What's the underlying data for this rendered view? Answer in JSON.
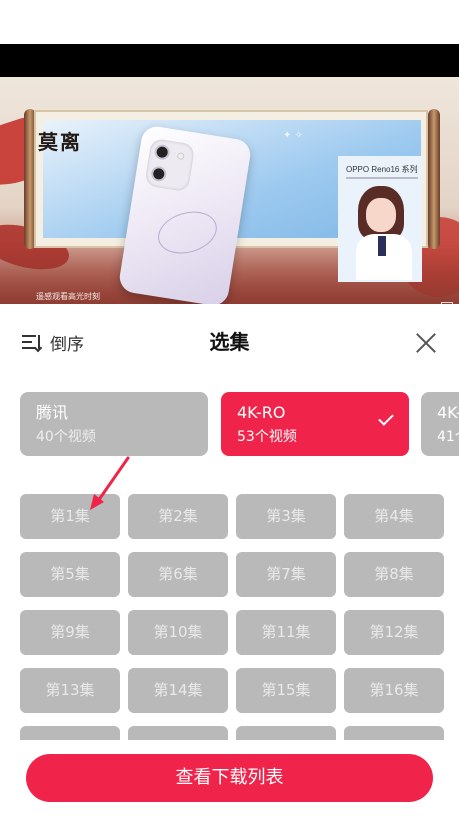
{
  "video": {
    "logo_text": "莫离",
    "brand": "OPPO Reno16 系列",
    "caption": "遥感观看高光时刻"
  },
  "panel": {
    "sort_label": "倒序",
    "title": "选集",
    "sources": [
      {
        "name": "腾讯",
        "count": "40个视频"
      },
      {
        "name": "4K-RO",
        "count": "53个视频"
      },
      {
        "name": "4K-",
        "count": "41个"
      }
    ],
    "selected_source_index": 1,
    "episodes": [
      "第1集",
      "第2集",
      "第3集",
      "第4集",
      "第5集",
      "第6集",
      "第7集",
      "第8集",
      "第9集",
      "第10集",
      "第11集",
      "第12集",
      "第13集",
      "第14集",
      "第15集",
      "第16集",
      "",
      "",
      "",
      ""
    ],
    "download_label": "查看下载列表"
  },
  "colors": {
    "accent": "#f0244a",
    "tile_gray": "#b9b9b9"
  }
}
